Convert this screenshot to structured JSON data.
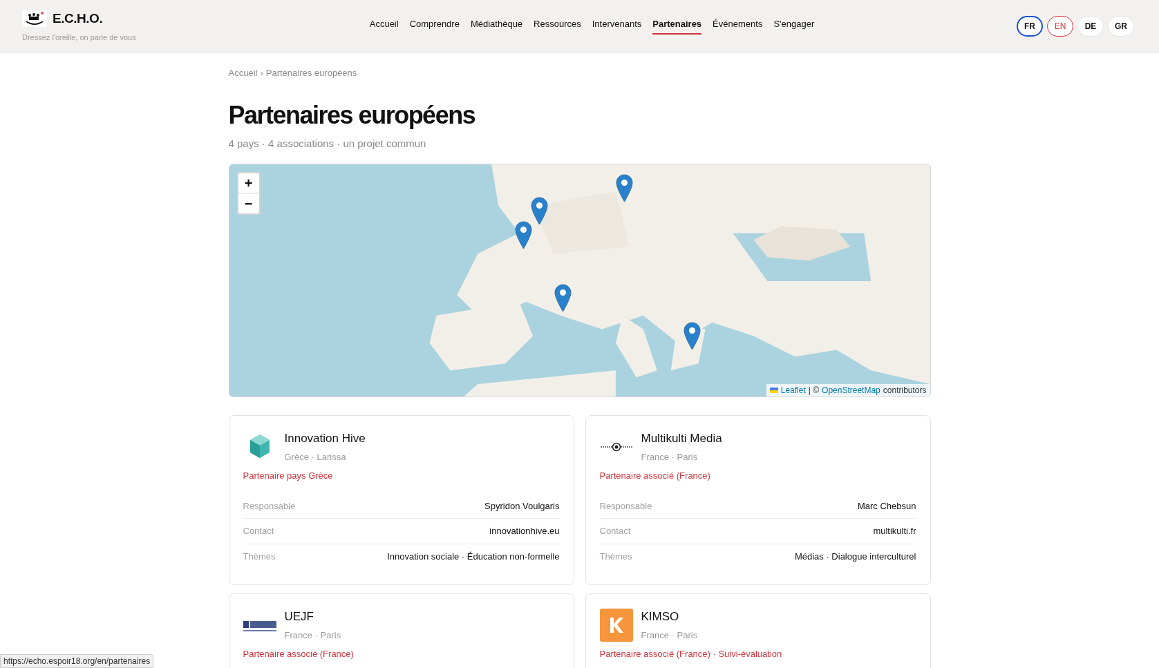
{
  "site": {
    "name": "E.C.H.O.",
    "tagline": "Dressez l'oreille, on parle de vous"
  },
  "nav": [
    {
      "label": "Accueil",
      "selected": false
    },
    {
      "label": "Comprendre",
      "selected": false
    },
    {
      "label": "Médiathèque",
      "selected": false
    },
    {
      "label": "Ressources",
      "selected": false
    },
    {
      "label": "Intervenants",
      "selected": false
    },
    {
      "label": "Partenaires",
      "selected": true
    },
    {
      "label": "Événements",
      "selected": false
    },
    {
      "label": "S'engager",
      "selected": false
    }
  ],
  "languages": [
    {
      "label": "FR",
      "selected": true,
      "hovered": false
    },
    {
      "label": "EN",
      "selected": false,
      "hovered": true
    },
    {
      "label": "DE",
      "selected": false,
      "hovered": false
    },
    {
      "label": "GR",
      "selected": false,
      "hovered": false
    }
  ],
  "breadcrumb": {
    "items": [
      "Accueil",
      "Partenaires européens"
    ],
    "separator": "›"
  },
  "title": "Partenaires européens",
  "subtitle": "4 pays · 4 associations · un projet commun",
  "map": {
    "zoom_in": "+",
    "zoom_out": "−",
    "attribution": {
      "leaflet": "Leaflet",
      "separator": "| ©",
      "osm": "OpenStreetMap",
      "suffix": "contributors"
    }
  },
  "partners": [
    {
      "name": "Innovation Hive",
      "location": "Grèce · Larissa",
      "role": "Partenaire pays Grèce",
      "kind": "hive",
      "details": [
        {
          "label": "Responsable",
          "value": "Spyridon Voulgaris"
        },
        {
          "label": "Contact",
          "value": "innovationhive.eu"
        },
        {
          "label": "Thèmes",
          "value": "Innovation sociale · Éducation non-formelle"
        }
      ]
    },
    {
      "name": "Multikulti Media",
      "location": "France · Paris",
      "role": "Partenaire associé (France)",
      "kind": "multikulti",
      "details": [
        {
          "label": "Responsable",
          "value": "Marc Chebsun"
        },
        {
          "label": "Contact",
          "value": "multikulti.fr"
        },
        {
          "label": "Thèmes",
          "value": "Médias · Dialogue interculturel"
        }
      ]
    },
    {
      "name": "UEJF",
      "location": "France · Paris",
      "role": "Partenaire associé (France)",
      "kind": "uejf"
    },
    {
      "name": "KIMSO",
      "location": "France · Paris",
      "role": "Partenaire associé (France) · Suivi-évaluation",
      "kind": "kimso"
    }
  ],
  "status_url": "https://echo.espoir18.org/en/partenaires"
}
